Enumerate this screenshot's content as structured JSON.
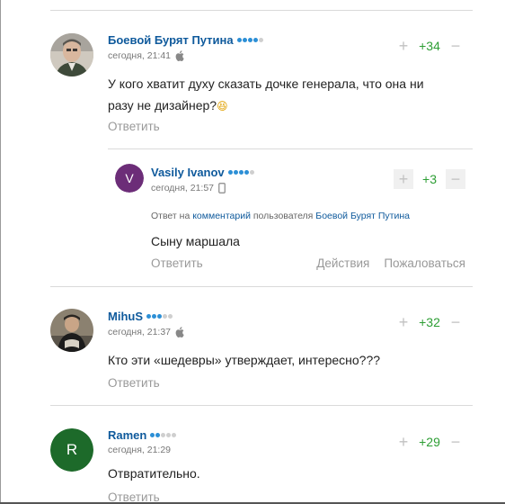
{
  "comments": [
    {
      "author": "Боевой Бурят Путина",
      "time": "сегодня, 21:41",
      "device_icon": "apple-icon",
      "rating_dots": [
        true,
        true,
        true,
        true,
        false
      ],
      "text_lines": [
        "У кого хватит духу сказать дочке генерала, что она ни",
        "разу не дизайнер?"
      ],
      "emoji": "😆",
      "score": "+34",
      "reply_label": "Ответить"
    },
    {
      "author": "Vasily Ivanov",
      "avatar_letter": "V",
      "avatar_color": "#6c2d78",
      "time": "сегодня, 21:57",
      "device_icon": "phone-icon",
      "rating_dots": [
        true,
        true,
        true,
        true,
        false
      ],
      "reply_to": {
        "prefix": "Ответ на",
        "link": "комментарий",
        "middle": "пользователя",
        "user": "Боевой Бурят Путина"
      },
      "text": "Сыну маршала",
      "score": "+3",
      "reply_label": "Ответить",
      "actions_label": "Действия",
      "report_label": "Пожаловаться"
    },
    {
      "author": "MihuS",
      "time": "сегодня, 21:37",
      "device_icon": "apple-icon",
      "rating_dots": [
        true,
        true,
        true,
        false,
        false
      ],
      "text": "Кто эти «шедевры» утверждает, интересно???",
      "score": "+32",
      "reply_label": "Ответить"
    },
    {
      "author": "Ramen",
      "avatar_letter": "R",
      "avatar_color": "#1d6a2a",
      "time": "сегодня, 21:29",
      "rating_dots": [
        true,
        true,
        false,
        false,
        false
      ],
      "text": "Отвратительно.",
      "score": "+29",
      "reply_label": "Ответить"
    }
  ],
  "colors": {
    "author": "#0f5a9c",
    "score": "#2d9e34",
    "dot_active": "#2c8fd6",
    "dot_inactive": "#cfcfcf"
  }
}
